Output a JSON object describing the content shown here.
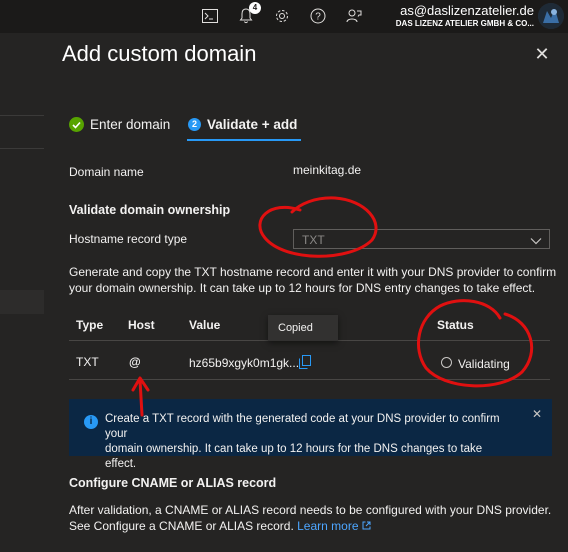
{
  "topbar": {
    "notification_count": "4",
    "account_email": "as@daslizenzatelier.de",
    "account_tenant": "DAS LIZENZ ATELIER GMBH & CO..."
  },
  "panel": {
    "title": "Add custom domain",
    "steps": [
      {
        "label": "Enter domain",
        "state": "done"
      },
      {
        "label": "Validate + add",
        "number": "2",
        "state": "active"
      }
    ],
    "domain_name_label": "Domain name",
    "domain_name_value": "meinkitag.de",
    "validate_heading": "Validate domain ownership",
    "hostname_record_type_label": "Hostname record type",
    "hostname_record_type_value": "TXT",
    "instructions_line1": "Generate and copy the TXT hostname record and enter it with your DNS provider to confirm",
    "instructions_line2": "your domain ownership. It can take up to 12 hours for DNS entry changes to take effect.",
    "table": {
      "headers": [
        "Type",
        "Host",
        "Value",
        "Status"
      ],
      "row": {
        "type": "TXT",
        "host": "@",
        "value": "hz65b9xgyk0m1gk...",
        "status": "Validating"
      }
    },
    "tooltip": "Copied",
    "info_line1": "Create a TXT record with the generated code at your DNS provider to confirm your",
    "info_line2": "domain ownership. It can take up to 12 hours for the DNS changes to take effect.",
    "cname_heading": "Configure CNAME or ALIAS record",
    "cname_line1": "After validation, a CNAME or ALIAS record needs to be configured with your DNS provider.",
    "cname_line2": "See Configure a CNAME or ALIAS record.",
    "learn_more": "Learn more"
  },
  "colors": {
    "accent": "#2899f5",
    "success": "#57a300",
    "annotation": "#e01010",
    "info_bg": "#0b2744"
  }
}
